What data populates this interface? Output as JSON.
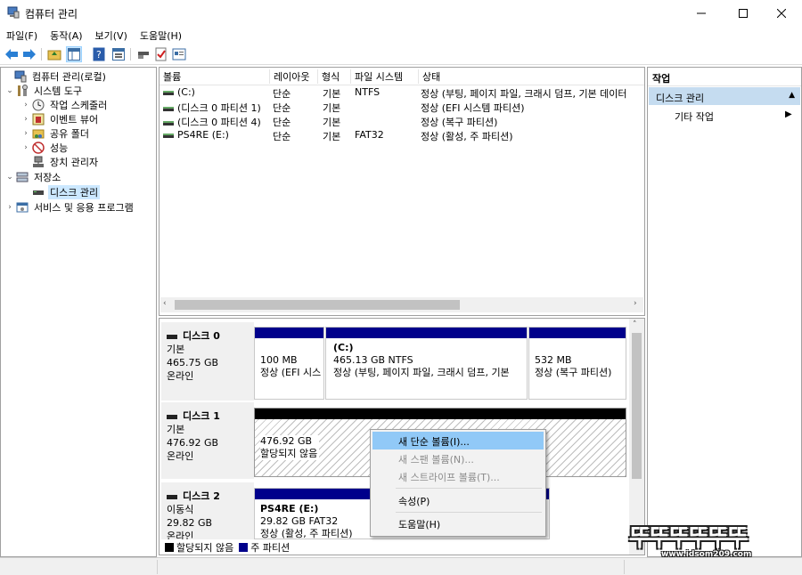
{
  "window": {
    "title": "컴퓨터 관리"
  },
  "menubar": [
    "파일(F)",
    "동작(A)",
    "보기(V)",
    "도움말(H)"
  ],
  "toolbar_icons": [
    "back-icon",
    "forward-icon",
    "up-folder-icon",
    "show-tree-icon",
    "help-icon",
    "properties-icon",
    "connect-icon",
    "check-icon",
    "export-icon"
  ],
  "tree": {
    "root": "컴퓨터 관리(로컬)",
    "system_tools": "시스템 도구",
    "task_scheduler": "작업 스케줄러",
    "event_viewer": "이벤트 뷰어",
    "shared_folders": "공유 폴더",
    "performance": "성능",
    "device_manager": "장치 관리자",
    "storage": "저장소",
    "disk_management": "디스크 관리",
    "services_apps": "서비스 및 응용 프로그램"
  },
  "volume_list": {
    "columns": [
      "볼륨",
      "레이아웃",
      "형식",
      "파일 시스템",
      "상태"
    ],
    "rows": [
      [
        "(C:)",
        "단순",
        "기본",
        "NTFS",
        "정상 (부팅, 페이지 파일, 크래시 덤프, 기본 데이터"
      ],
      [
        "(디스크 0 파티션 1)",
        "단순",
        "기본",
        "",
        "정상 (EFI 시스템 파티션)"
      ],
      [
        "(디스크 0 파티션 4)",
        "단순",
        "기본",
        "",
        "정상 (복구 파티션)"
      ],
      [
        "PS4RE (E:)",
        "단순",
        "기본",
        "FAT32",
        "정상 (활성, 주 파티션)"
      ]
    ]
  },
  "disks": [
    {
      "name": "디스크 0",
      "type": "기본",
      "size": "465.75 GB",
      "status": "온라인",
      "partitions": [
        {
          "title": "",
          "size": "100 MB",
          "status": "정상 (EFI 시스"
        },
        {
          "title": "(C:)",
          "size": "465.13 GB NTFS",
          "status": "정상 (부팅, 페이지 파일, 크래시 덤프, 기본"
        },
        {
          "title": "",
          "size": "532 MB",
          "status": "정상 (복구 파티션)"
        }
      ]
    },
    {
      "name": "디스크 1",
      "type": "기본",
      "size": "476.92 GB",
      "status": "온라인",
      "partitions": [
        {
          "title": "",
          "size": "476.92 GB",
          "status": "할당되지 않음"
        }
      ]
    },
    {
      "name": "디스크 2",
      "type": "이동식",
      "size": "29.82 GB",
      "status": "온라인",
      "partitions": [
        {
          "title": "PS4RE  (E:)",
          "size": "29.82 GB FAT32",
          "status": "정상 (활성, 주 파티션)"
        }
      ]
    }
  ],
  "legend": {
    "unallocated": "할당되지 않음",
    "primary": "주 파티션",
    "unallocated_color": "#000000",
    "primary_color": "#00008b"
  },
  "context_menu": {
    "new_simple": "새 단순 볼륨(I)...",
    "new_spanned": "새 스팬 볼륨(N)...",
    "new_striped": "새 스트라이프 볼륨(T)...",
    "properties": "속성(P)",
    "help": "도움말(H)"
  },
  "actions": {
    "header": "작업",
    "section": "디스크 관리",
    "more": "기타 작업"
  },
  "watermark": {
    "logo": "뚜뚜뚜뚜뚜뚜",
    "url": "www.idsom209.com"
  },
  "colors": {
    "selection": "#cce8ff",
    "menu_highlight": "#91c9f7",
    "action_header": "#c5dcf0",
    "partition_bar": "#00008b"
  }
}
